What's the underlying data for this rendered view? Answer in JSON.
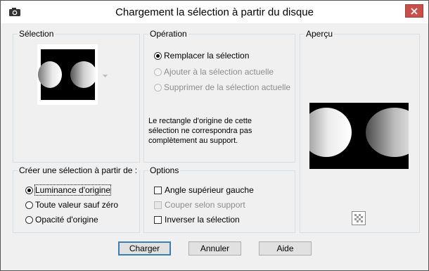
{
  "window": {
    "title": "Chargement la sélection à partir du disque",
    "app_icon": "camera-icon",
    "close_icon": "close-icon"
  },
  "selection_group": {
    "label": "Sélection",
    "dropdown_icon": "chevron-down-icon"
  },
  "operation_group": {
    "label": "Opération",
    "options": [
      {
        "label": "Remplacer la sélection",
        "checked": true,
        "enabled": true
      },
      {
        "label": "Ajouter à la sélection actuelle",
        "checked": false,
        "enabled": false
      },
      {
        "label": "Supprimer de la sélection actuelle",
        "checked": false,
        "enabled": false
      }
    ],
    "info": [
      "Le rectangle d'origine de cette",
      "sélection ne correspondra pas",
      "complètement au support."
    ]
  },
  "preview_group": {
    "label": "Aperçu",
    "transparency_icon": "checkerboard-icon"
  },
  "create_group": {
    "label": "Créer une sélection à partir de :",
    "options": [
      {
        "label": "Luminance d'origine",
        "checked": true
      },
      {
        "label": "Toute valeur sauf zéro",
        "checked": false
      },
      {
        "label": "Opacité d'origine",
        "checked": false
      }
    ]
  },
  "options_group": {
    "label": "Options",
    "items": [
      {
        "label": "Angle supérieur gauche",
        "checked": false,
        "enabled": true
      },
      {
        "label": "Couper selon support",
        "checked": false,
        "enabled": false
      },
      {
        "label": "Inverser la sélection",
        "checked": false,
        "enabled": true
      }
    ]
  },
  "buttons": {
    "load": "Charger",
    "cancel": "Annuler",
    "help": "Aide"
  },
  "colors": {
    "window_bg": "#f0f0f0",
    "group_border": "#d5dfe5",
    "close_red": "#c7504b",
    "default_button_border": "#3c7fb1"
  }
}
